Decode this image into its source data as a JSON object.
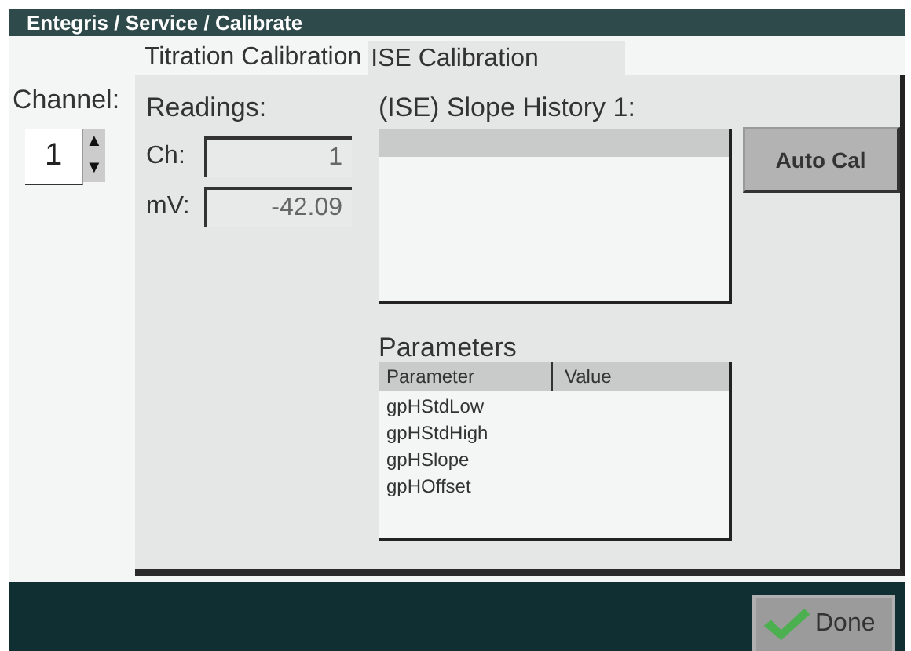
{
  "window": {
    "title": "Entegris / Service / Calibrate"
  },
  "tabs": [
    {
      "label": "Titration Calibration",
      "selected": false
    },
    {
      "label": "ISE Calibration",
      "selected": true
    }
  ],
  "channel": {
    "label": "Channel:",
    "value": "1",
    "up": "▲",
    "down": "▼"
  },
  "readings": {
    "title": "Readings:",
    "fields": [
      {
        "label": "Ch:",
        "value": "1"
      },
      {
        "label": "mV:",
        "value": "-42.09"
      }
    ]
  },
  "slope_history": {
    "title": "(ISE) Slope History 1:"
  },
  "auto_cal_button": "Auto Cal",
  "parameters": {
    "title": "Parameters",
    "columns": [
      "Parameter",
      "Value"
    ],
    "rows": [
      [
        "gpHStdLow"
      ],
      [
        "gpHStdHigh"
      ],
      [
        "gpHSlope"
      ],
      [
        "gpHOffset"
      ]
    ]
  },
  "done_button": "Done"
}
